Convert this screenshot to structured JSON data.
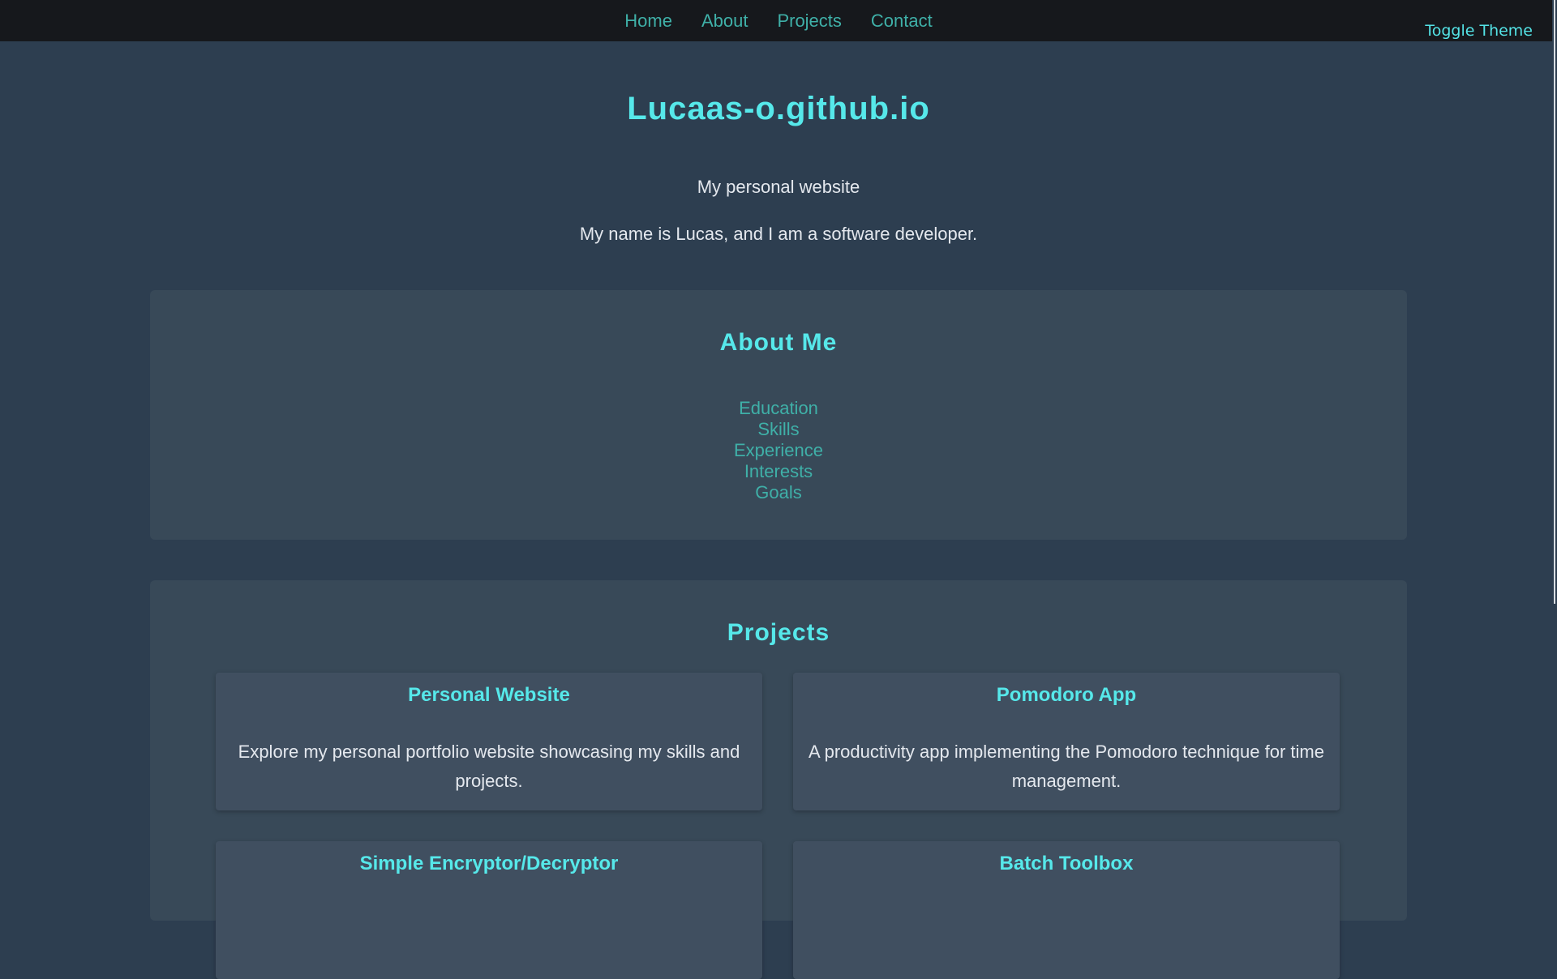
{
  "nav": {
    "links": [
      {
        "label": "Home"
      },
      {
        "label": "About"
      },
      {
        "label": "Projects"
      },
      {
        "label": "Contact"
      }
    ],
    "toggle_theme": "Toggle Theme"
  },
  "header": {
    "title": "Lucaas-o.github.io",
    "tagline": "My personal website",
    "intro": "My name is Lucas, and I am a software developer."
  },
  "about": {
    "title": "About Me",
    "items": [
      {
        "label": "Education"
      },
      {
        "label": "Skills"
      },
      {
        "label": "Experience"
      },
      {
        "label": "Interests"
      },
      {
        "label": "Goals"
      }
    ]
  },
  "projects": {
    "title": "Projects",
    "cards": [
      {
        "title": "Personal Website",
        "description": "Explore my personal portfolio website showcasing my skills and projects."
      },
      {
        "title": "Pomodoro App",
        "description": "A productivity app implementing the Pomodoro technique for time management."
      },
      {
        "title": "Simple Encryptor/Decryptor",
        "description": ""
      },
      {
        "title": "Batch Toolbox",
        "description": ""
      }
    ]
  },
  "colors": {
    "background": "#2d3e50",
    "nav_background": "#16181c",
    "accent": "#56e8ea",
    "link": "#3fb0a8",
    "section_background": "#384958",
    "card_background": "#404f60",
    "text": "#e4e8ee"
  }
}
